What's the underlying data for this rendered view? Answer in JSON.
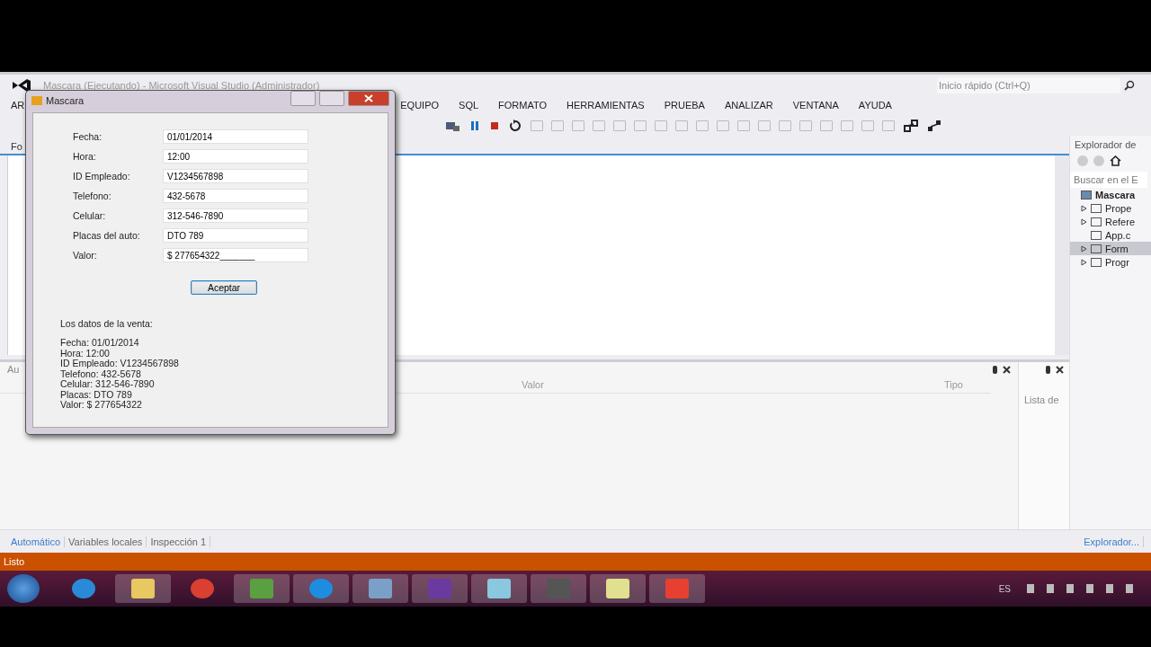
{
  "ide": {
    "title": "Mascara (Ejecutando) - Microsoft Visual Studio (Administrador)",
    "quick_launch": {
      "placeholder": "Inicio rápido (Ctrl+Q)"
    },
    "menu": [
      "AR",
      "EQUIPO",
      "SQL",
      "FORMATO",
      "HERRAMIENTAS",
      "PRUEBA",
      "ANALIZAR",
      "VENTANA",
      "AYUDA"
    ],
    "document_tab": "Fo",
    "solution_explorer": {
      "title": "Explorador de",
      "search": {
        "placeholder": "Buscar en el E"
      },
      "tree": [
        {
          "label": "Mascara",
          "selected": false,
          "children": [
            {
              "label": "Prope",
              "kind": "expandable",
              "selected": false
            },
            {
              "label": "Refere",
              "kind": "expandable",
              "selected": false
            },
            {
              "label": "App.c",
              "kind": "leaf",
              "selected": false
            },
            {
              "label": "Form",
              "kind": "expandable",
              "selected": true
            },
            {
              "label": "Progr",
              "kind": "expandable",
              "selected": false
            }
          ]
        }
      ]
    },
    "autos_panel": {
      "title": "Au",
      "columns": [
        "Valor",
        "Tipo"
      ]
    },
    "side_panel": {
      "title": "Lista de"
    },
    "bottom_tabs": [
      {
        "label": "Automático",
        "selected": true
      },
      {
        "label": "Variables locales",
        "selected": false
      },
      {
        "label": "Inspección 1",
        "selected": false
      }
    ],
    "right_bottom_tab": "Explorador...",
    "status_bar": "Listo"
  },
  "dialog": {
    "title": "Mascara",
    "fields": [
      {
        "label": "Fecha:",
        "value": "01/01/2014"
      },
      {
        "label": "Hora:",
        "value": "12:00"
      },
      {
        "label": "ID Empleado:",
        "value": "V1234567898"
      },
      {
        "label": "Telefono:",
        "value": "432-5678"
      },
      {
        "label": "Celular:",
        "value": "312-546-7890"
      },
      {
        "label": "Placas del auto:",
        "value": "DTO 789"
      },
      {
        "label": "Valor:",
        "value": "$ 277654322_______"
      }
    ],
    "button": "Aceptar",
    "output_heading": "Los datos de la venta:",
    "output_lines": [
      "Fecha: 01/01/2014",
      "Hora: 12:00",
      "ID Empleado: V1234567898",
      "Telefono: 432-5678",
      "Celular: 312-546-7890",
      "Placas: DTO 789",
      "Valor: $ 277654322"
    ]
  },
  "taskbar": {
    "language": "ES"
  }
}
